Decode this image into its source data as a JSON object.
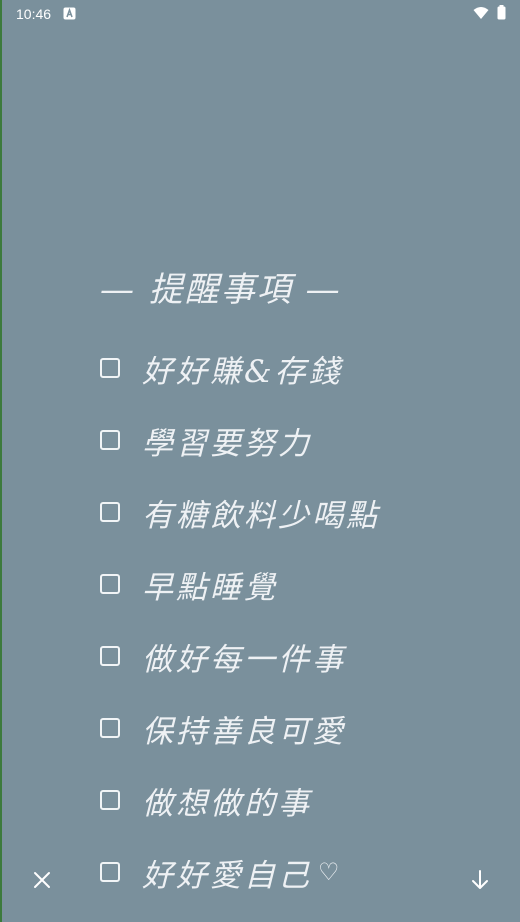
{
  "status_bar": {
    "time": "10:46",
    "notification_icon": "a-notification-icon",
    "wifi_icon": "wifi-icon",
    "battery_icon": "battery-icon"
  },
  "note": {
    "heading": "— 提醒事項 —",
    "items": [
      {
        "text": "好好賺&存錢",
        "checked": false
      },
      {
        "text": "學習要努力",
        "checked": false
      },
      {
        "text": "有糖飲料少喝點",
        "checked": false
      },
      {
        "text": "早點睡覺",
        "checked": false
      },
      {
        "text": "做好每一件事",
        "checked": false
      },
      {
        "text": "保持善良可愛",
        "checked": false
      },
      {
        "text": "做想做的事",
        "checked": false
      },
      {
        "text": "好好愛自己",
        "checked": false
      }
    ],
    "last_item_icon": "heart-icon"
  },
  "controls": {
    "close_icon": "close-icon",
    "download_icon": "arrow-down-icon"
  },
  "colors": {
    "background": "#7a909c",
    "text": "#eef1f4"
  }
}
